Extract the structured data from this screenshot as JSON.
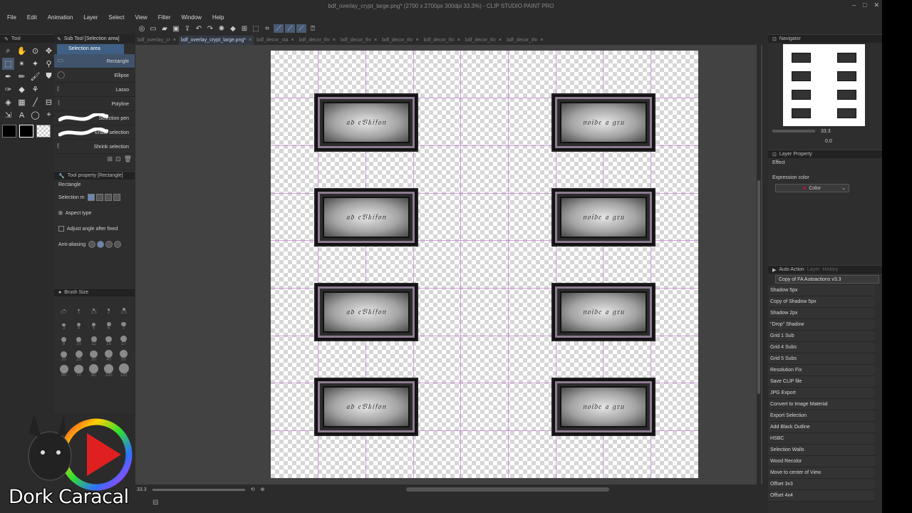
{
  "window": {
    "title": "bdf_overlay_crypt_large.png* (2700 x 2700px 300dpi 33.3%)  - CLIP STUDIO PAINT PRO"
  },
  "menu": [
    "File",
    "Edit",
    "Animation",
    "Layer",
    "Select",
    "View",
    "Filter",
    "Window",
    "Help"
  ],
  "tool_panel": {
    "header": "Tool",
    "tools": [
      "zoom-icon",
      "hand-icon",
      "move-icon",
      "selection-icon",
      "lasso-icon",
      "magic-wand-icon",
      "eyedropper-icon",
      "pen-icon",
      "pencil-icon",
      "brush-icon",
      "airbrush-icon",
      "eraser-icon",
      "fill-icon",
      "gradient-icon",
      "figure-icon",
      "frame-icon",
      "text-icon",
      "balloon-icon",
      "ruler-icon",
      "correct-line-icon"
    ]
  },
  "sub_tool": {
    "header": "Sub Tool [Selection area]",
    "group_title": "Selection area",
    "items": [
      {
        "label": "Rectangle",
        "selected": true
      },
      {
        "label": "Ellipse",
        "selected": false
      },
      {
        "label": "Lasso",
        "selected": false
      },
      {
        "label": "Polyline",
        "selected": false
      },
      {
        "label": "Selection pen",
        "selected": false
      },
      {
        "label": "Erase selection",
        "selected": false
      },
      {
        "label": "Shrink selection",
        "selected": false
      }
    ]
  },
  "tool_property": {
    "header": "Tool property [Rectangle]",
    "name": "Rectangle",
    "selection_mode_label": "Selection m",
    "aspect_label": "Aspect type",
    "adjust_label": "Adjust angle after fixed",
    "aa_label": "Anti-aliasing"
  },
  "brush_size": {
    "header": "Brush Size",
    "sizes": [
      "0.7",
      "1",
      "1.5",
      "2",
      "2.5",
      "3",
      "4",
      "5",
      "6",
      "7",
      "8",
      "10",
      "12",
      "15",
      "17",
      "20",
      "25",
      "30",
      "40",
      "50",
      "60",
      "70",
      "80",
      "100",
      "120"
    ]
  },
  "branding": {
    "logo_text": "Dork Caracal"
  },
  "doc_tabs": [
    {
      "label": "bdf_overlay_cr",
      "active": false
    },
    {
      "label": "bdf_overlay_crypt_large.png*",
      "active": true
    },
    {
      "label": "bdf_decor_sta",
      "active": false
    },
    {
      "label": "bdf_decor_thr",
      "active": false
    },
    {
      "label": "bdf_decor_thr",
      "active": false
    },
    {
      "label": "bdf_decor_thr",
      "active": false
    },
    {
      "label": "bdf_decor_thr",
      "active": false
    },
    {
      "label": "bdf_decor_thr",
      "active": false
    },
    {
      "label": "bdf_decor_thr",
      "active": false
    }
  ],
  "canvas": {
    "plaque_left_text": "𝔞𝔡 𝔢𝔙𝔨𝔦𝔣𝔬𝔫",
    "plaque_right_text": "𝔫𝔬𝔦𝔡𝔢 𝔞 𝔤𝔯𝔲"
  },
  "status": {
    "zoom": "33.3",
    "angle": "0.0"
  },
  "navigator": {
    "header": "Navigator",
    "zoom": "33.3",
    "rotation": "0.0"
  },
  "layer_property": {
    "tab": "Layer Property",
    "effect_label": "Effect",
    "expression_label": "Expression color",
    "expression_value": "Color"
  },
  "auto_action": {
    "tabs": [
      "Auto Action",
      "Layer",
      "History"
    ],
    "set_name": "Copy of FA Autoactions v3.3",
    "items": [
      "Shadow 5px",
      "Copy of Shadow 5px",
      "Shadow 2px",
      "\"Drop\" Shadow",
      "Grid 1 Sub",
      "Grid 4 Subs",
      "Grid 5 Subs",
      "Resolution Fix",
      "Save CLIP file",
      "JPG Export",
      "Convert to Image Material",
      "Export Selection",
      "Add Black Outline",
      "HSBC",
      "Selection Walls",
      "Wood Recolor",
      "Move to center of View",
      "Offset 3x3",
      "Offset 4x4"
    ]
  },
  "colors": {
    "accent": "#3f5f85",
    "grid": "#c27ad1",
    "plaque_frame": "#8e7a93"
  }
}
